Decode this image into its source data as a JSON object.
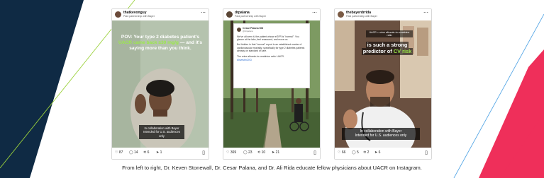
{
  "caption": "From left to right, Dr. Keven Stonewall, Dr. Cesar Palana, and Dr. Ali Rida educate fellow physicians about UACR on Instagram.",
  "colors": {
    "navy": "#0f2a44",
    "pink": "#ef2f5a",
    "green_line": "#9bd13b",
    "blue_line": "#5aa9e6",
    "highlight": "#9be94a"
  },
  "cards": [
    {
      "username": "thatkevonguy",
      "subtitle": "Paid partnership with Bayer",
      "headline_pre": "POV: Your type 2 diabetes patient's",
      "headline_hl": "UACR came back ≥30 mg/g",
      "headline_post": "— and it's saying more than you think.",
      "disclaimer": "In collaboration with Bayer\nIntended for U.S. audiences only",
      "likes": "87",
      "comments": "14",
      "reposts": "6",
      "shares": "1"
    },
    {
      "username": "drpalana",
      "subtitle": "Paid partnership with Bayer",
      "post_author": "Cesar Palana MD",
      "post_handle": "@drpalana",
      "post_p1": "We've all seen it, the patient whose eGFR is \"normal\". You glance at the labs, feel reassured, and move on.",
      "post_p2": "But hidden in that \"normal\" report is an established marker of cardiovascular mortality, specifically for type 2 diabetes patients already on standard of care.",
      "post_p3": "The urine albumin-to-creatinine ratio: UACR.",
      "post_tag": "#InvestInCKD",
      "likes": "369",
      "comments": "23",
      "reposts": "10",
      "shares": "21"
    },
    {
      "username": "thebayerdrrida",
      "subtitle": "Paid partnership with Bayer",
      "top_label": "UACR = urine albumin-to-creatinine ratio",
      "line1": "is such a strong",
      "line2_pre": "predictor of ",
      "line2_hl": "CV risk",
      "disclaimer": "In collaboration with Bayer\nIntended for U.S. audiences only",
      "likes": "66",
      "comments": "5",
      "reposts": "2",
      "shares": "6"
    }
  ],
  "icons": [
    "heart-icon",
    "comment-icon",
    "repost-icon",
    "share-icon",
    "bookmark-icon",
    "more-icon",
    "verified-icon"
  ]
}
